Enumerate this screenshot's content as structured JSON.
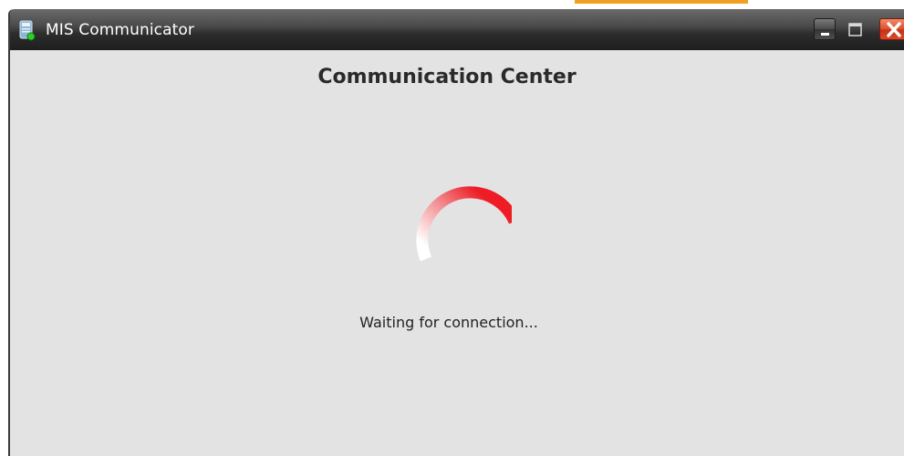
{
  "window": {
    "title": "MIS Communicator",
    "accent_color": "#f0a020"
  },
  "main": {
    "heading": "Communication Center",
    "status_text": "Waiting for connection...",
    "spinner_color": "#ee1c25"
  },
  "icons": {
    "app": "mis-communicator-app-icon",
    "minimize": "minimize-icon",
    "maximize": "maximize-icon",
    "close": "close-icon",
    "spinner": "loading-spinner"
  }
}
